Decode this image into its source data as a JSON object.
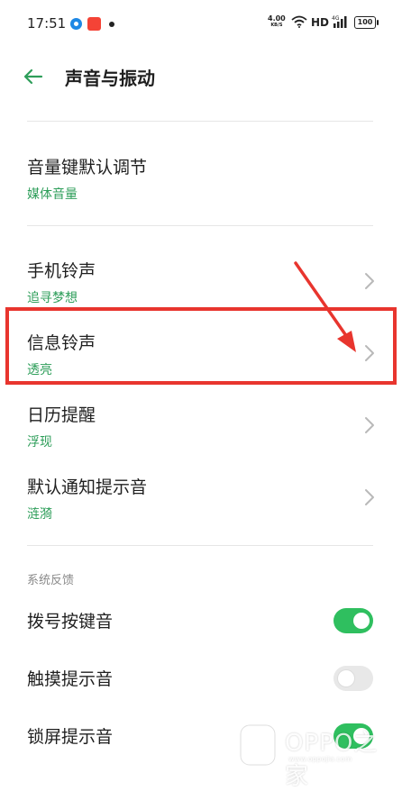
{
  "status_bar": {
    "time": "17:51",
    "speed_value": "4.00",
    "speed_unit": "KB/S",
    "hd": "HD",
    "network": "4G",
    "battery": "100"
  },
  "header": {
    "title": "声音与振动",
    "back_icon": "back-arrow-icon"
  },
  "settings": {
    "items": [
      {
        "title": "音量键默认调节",
        "value": "媒体音量"
      },
      {
        "title": "手机铃声",
        "value": "追寻梦想"
      },
      {
        "title": "信息铃声",
        "value": "透亮"
      },
      {
        "title": "日历提醒",
        "value": "浮现"
      },
      {
        "title": "默认通知提示音",
        "value": "涟漪"
      }
    ]
  },
  "system_feedback": {
    "section_label": "系统反馈",
    "toggles": [
      {
        "title": "拨号按键音",
        "state": "on"
      },
      {
        "title": "触摸提示音",
        "state": "off"
      },
      {
        "title": "锁屏提示音",
        "state": "on"
      }
    ]
  },
  "watermark": {
    "text": "OPPO之家",
    "url": "www.oppojia.com"
  },
  "colors": {
    "accent_green": "#2e9e5a",
    "toggle_on": "#2fbf5f",
    "annotation_red": "#e8352e"
  }
}
